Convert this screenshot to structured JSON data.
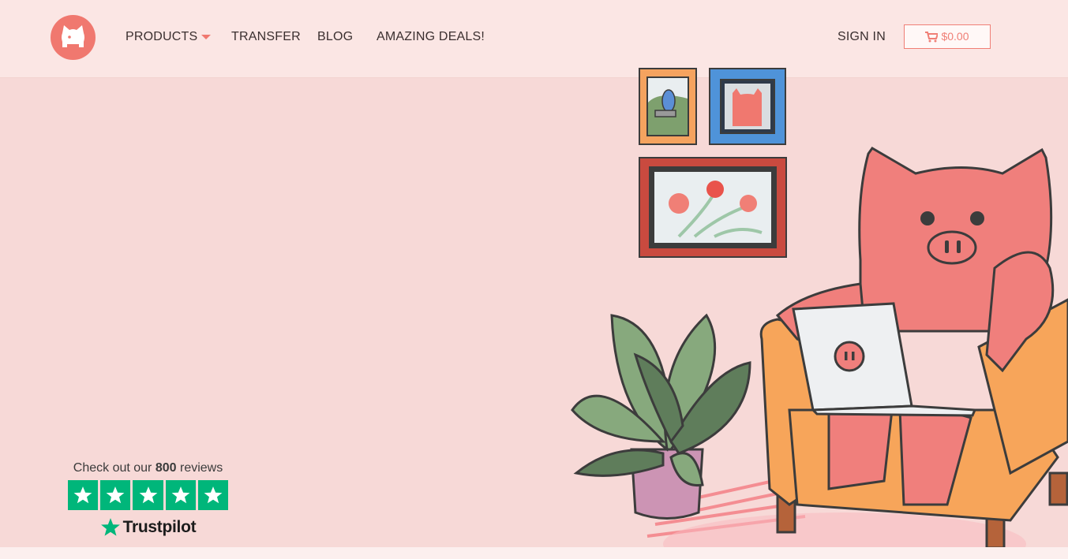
{
  "nav": {
    "products": "PRODUCTS",
    "transfer": "TRANSFER",
    "blog": "BLOG",
    "deals": "AMAZING DEALS!",
    "sign_in": "SIGN IN",
    "cart_total": "$0.00"
  },
  "reviews": {
    "prefix": "Check out our",
    "count": "800",
    "suffix": "reviews",
    "rating_stars": 5,
    "brand": "Trustpilot"
  },
  "colors": {
    "accent": "#f0786f",
    "header_bg": "#fbe6e4",
    "hero_bg": "#f7d9d7",
    "trustpilot_green": "#00b67a"
  },
  "icons": [
    "piggy-logo-icon",
    "chevron-down-icon",
    "cart-icon",
    "star-icon",
    "trustpilot-star-icon"
  ]
}
